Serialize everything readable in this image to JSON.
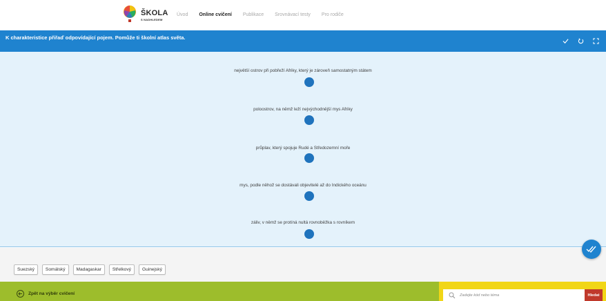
{
  "brand": {
    "name": "ŠKOLA",
    "tagline": "S NADHLEDEM"
  },
  "nav": {
    "items": [
      {
        "label": "Úvod",
        "active": false
      },
      {
        "label": "Online cvičení",
        "active": true
      },
      {
        "label": "Publikace",
        "active": false
      },
      {
        "label": "Srovnávací testy",
        "active": false
      },
      {
        "label": "Pro rodiče",
        "active": false
      }
    ]
  },
  "task": {
    "title": "K charakteristice přiřaď odpovídající pojem. Pomůže ti školní atlas světa.",
    "icons": [
      "check-icon",
      "reset-icon",
      "fullscreen-icon"
    ]
  },
  "items": [
    {
      "text": "největší ostrov při pobřeží Afriky, který je zároveň samostatným státem"
    },
    {
      "text": "poloostrov, na němž leží nejvýchodnější mys Afriky"
    },
    {
      "text": "průplav, který spojuje Rudé a Středozemní moře"
    },
    {
      "text": "mys, podle něhož se dostávali objevitelé až do Indického oceánu"
    },
    {
      "text": "záliv, v němž se protíná nultá rovnoběžka s rovníkem"
    }
  ],
  "word_bank": [
    "Suezský",
    "Somálský",
    "Madagaskar",
    "Střelkový",
    "Guinejský"
  ],
  "footer": {
    "back_label": "Zpět na výběr cvičení",
    "search_placeholder": "Zadejte kód nebo téma",
    "search_button": "Hledat"
  },
  "colors": {
    "primary_blue": "#1f83cf",
    "dot_blue": "#1f73bd",
    "exercise_bg": "#e4f2fb",
    "footer_green": "#9dbd2c",
    "footer_yellow": "#f1d617",
    "search_red": "#c0392b"
  }
}
